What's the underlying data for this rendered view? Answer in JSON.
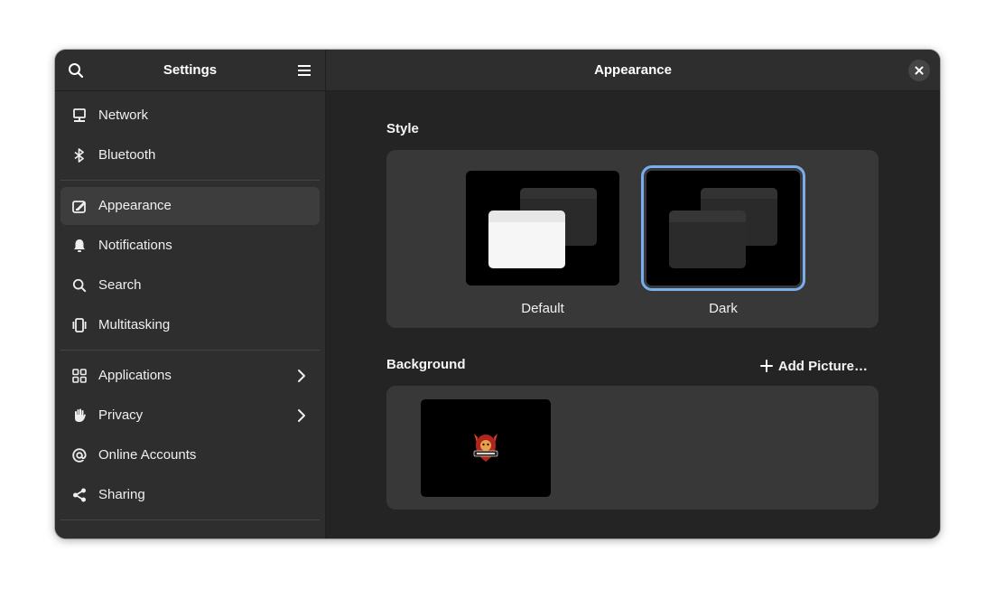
{
  "sidebar": {
    "title": "Settings",
    "items": [
      {
        "label": "Network",
        "icon": "network-icon"
      },
      {
        "label": "Bluetooth",
        "icon": "bluetooth-icon"
      },
      {
        "label": "Appearance",
        "icon": "appearance-icon",
        "active": true
      },
      {
        "label": "Notifications",
        "icon": "bell-icon"
      },
      {
        "label": "Search",
        "icon": "search-icon"
      },
      {
        "label": "Multitasking",
        "icon": "multitasking-icon"
      },
      {
        "label": "Applications",
        "icon": "applications-icon",
        "has_submenu": true
      },
      {
        "label": "Privacy",
        "icon": "hand-icon",
        "has_submenu": true
      },
      {
        "label": "Online Accounts",
        "icon": "at-icon"
      },
      {
        "label": "Sharing",
        "icon": "share-icon"
      }
    ]
  },
  "main": {
    "title": "Appearance",
    "style_section": {
      "label": "Style",
      "options": [
        {
          "label": "Default",
          "selected": false
        },
        {
          "label": "Dark",
          "selected": true
        }
      ]
    },
    "background_section": {
      "label": "Background",
      "add_button": "Add Picture…"
    }
  },
  "colors": {
    "accent": "#78aeed",
    "window_bg": "#242424",
    "sidebar_bg": "#2e2e2e",
    "card_bg": "#383838"
  }
}
